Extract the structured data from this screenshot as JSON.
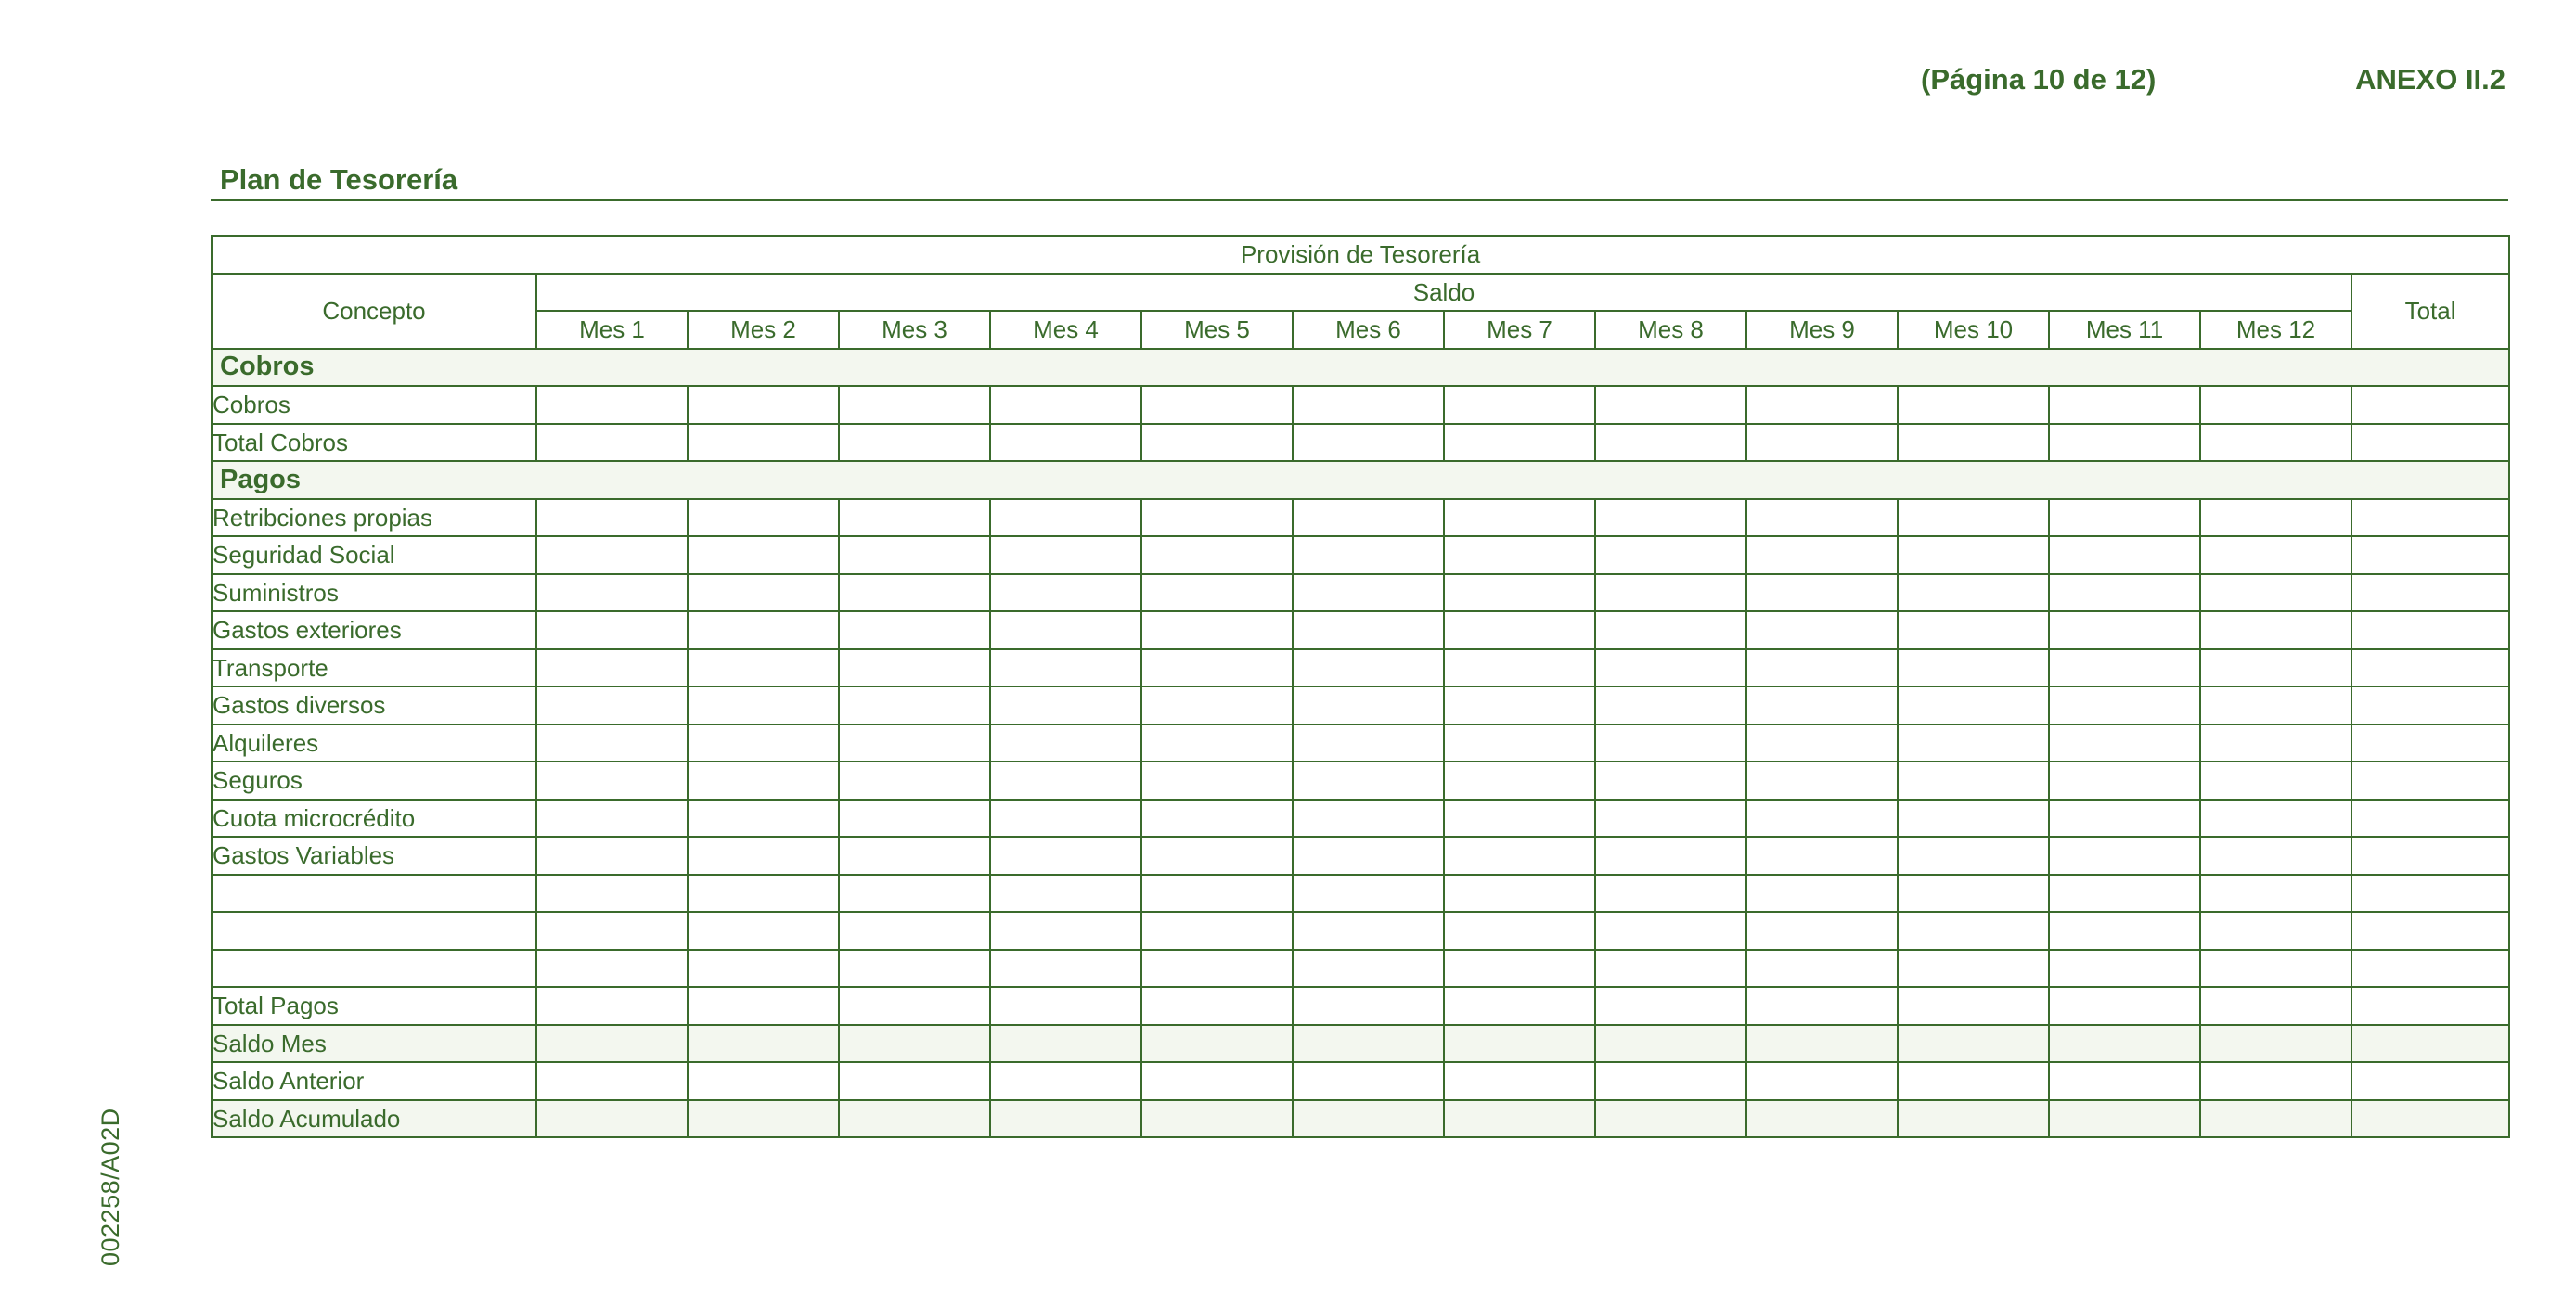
{
  "header": {
    "page_counter": "(Página 10 de 12)",
    "annex": "ANEXO II.2"
  },
  "section": {
    "title": "Plan de Tesorería"
  },
  "side_code": "002258/A02D",
  "table": {
    "title": "Provisión de Tesorería",
    "concept_header": "Concepto",
    "saldo_header": "Saldo",
    "total_header": "Total",
    "months": [
      "Mes 1",
      "Mes 2",
      "Mes 3",
      "Mes 4",
      "Mes 5",
      "Mes 6",
      "Mes 7",
      "Mes 8",
      "Mes 9",
      "Mes 10",
      "Mes 11",
      "Mes 12"
    ],
    "sections": {
      "cobros": "Cobros",
      "pagos": "Pagos"
    },
    "rows": {
      "cobros": "Cobros",
      "total_cobros": "Total Cobros",
      "retribuciones": "Retribciones propias",
      "seguridad_social": "Seguridad Social",
      "suministros": "Suministros",
      "gastos_exteriores": "Gastos exteriores",
      "transporte": "Transporte",
      "gastos_diversos": "Gastos diversos",
      "alquileres": "Alquileres",
      "seguros": "Seguros",
      "cuota_microcredito": "Cuota microcrédito",
      "gastos_variables": "Gastos Variables",
      "total_pagos": "Total Pagos",
      "saldo_mes": "Saldo Mes",
      "saldo_anterior": "Saldo Anterior",
      "saldo_acumulado": "Saldo Acumulado"
    }
  },
  "colors": {
    "brand_green": "#3a6b2c",
    "row_tint": "#f3f7ef"
  }
}
